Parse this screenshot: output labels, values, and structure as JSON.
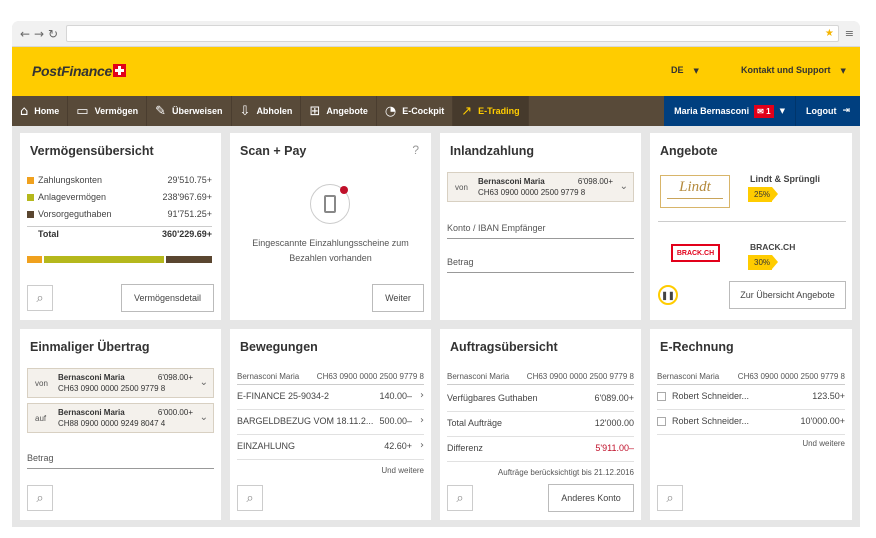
{
  "browser": {
    "back_icon": "back-arrow-icon",
    "forward_icon": "forward-arrow-icon",
    "reload_icon": "reload-icon"
  },
  "brand": {
    "name": "PostFinance",
    "color": "#ffcc00",
    "nav_color": "#584a39",
    "account_color": "#003f7f"
  },
  "header": {
    "language": "DE",
    "support": "Kontakt und Support"
  },
  "nav": {
    "items": [
      {
        "label": "Home",
        "icon": "house-icon"
      },
      {
        "label": "Vermögen",
        "icon": "wallet-icon"
      },
      {
        "label": "Überweisen",
        "icon": "pen-icon"
      },
      {
        "label": "Abholen",
        "icon": "download-icon"
      },
      {
        "label": "Angebote",
        "icon": "gift-icon"
      },
      {
        "label": "E-Cockpit",
        "icon": "chart-pie-icon"
      },
      {
        "label": "E-Trading",
        "icon": "trend-icon"
      }
    ],
    "user": "Maria Bernasconi",
    "messages": "1",
    "logout": "Logout"
  },
  "vermoegen": {
    "title": "Vermögensübersicht",
    "rows": [
      {
        "label": "Zahlungskonten",
        "value": "29'510.75+",
        "color": "#f0a11e"
      },
      {
        "label": "Anlagevermögen",
        "value": "238'967.69+",
        "color": "#b5b81c"
      },
      {
        "label": "Vorsorgeguthaben",
        "value": "91'751.25+",
        "color": "#5a4630"
      }
    ],
    "total_label": "Total",
    "total_value": "360'229.69+",
    "shares": [
      0.082,
      0.663,
      0.255
    ],
    "button": "Vermögensdetail"
  },
  "scanpay": {
    "title": "Scan + Pay",
    "help": "?",
    "message": "Eingescannte Einzahlungsscheine zum Bezahlen vorhanden",
    "button": "Weiter"
  },
  "inland": {
    "title": "Inlandzahlung",
    "from_label": "von",
    "name": "Bernasconi Maria",
    "iban": "CH63 0900 0000 2500 9779 8",
    "amount": "6'098.00+",
    "iban_field": "Konto / IBAN Empfänger",
    "amount_field": "Betrag"
  },
  "angebote": {
    "title": "Angebote",
    "offers": [
      {
        "name": "Lindt & Sprüngli",
        "discount": "25%",
        "logo": "Lindt"
      },
      {
        "name": "BRACK.CH",
        "discount": "30%",
        "logo": "BRACK.CH"
      }
    ],
    "button": "Zur Übersicht Angebote"
  },
  "uebertrag": {
    "title": "Einmaliger Übertrag",
    "from": {
      "label": "von",
      "name": "Bernasconi Maria",
      "iban": "CH63 0900 0000 2500 9779 8",
      "amount": "6'098.00+"
    },
    "to": {
      "label": "auf",
      "name": "Bernasconi Maria",
      "iban": "CH88 0900 0000 9249 8047 4",
      "amount": "6'000.00+"
    },
    "amount_field": "Betrag"
  },
  "bewegungen": {
    "title": "Bewegungen",
    "owner": "Bernasconi Maria",
    "iban": "CH63 0900 0000 2500 9779 8",
    "items": [
      {
        "label": "E-FINANCE 25-9034-2",
        "value": "140.00–"
      },
      {
        "label": "BARGELDBEZUG VOM 18.11.2...",
        "value": "500.00–"
      },
      {
        "label": "EINZAHLUNG",
        "value": "42.60+"
      }
    ],
    "more": "Und weitere"
  },
  "auftraege": {
    "title": "Auftragsübersicht",
    "owner": "Bernasconi Maria",
    "iban": "CH63 0900 0000 2500 9779 8",
    "rows": [
      {
        "label": "Verfügbares Guthaben",
        "value": "6'089.00+"
      },
      {
        "label": "Total Aufträge",
        "value": "12'000.00"
      },
      {
        "label": "Differenz",
        "value": "5'911.00–"
      }
    ],
    "note": "Aufträge berücksichtigt bis 21.12.2016",
    "button": "Anderes Konto"
  },
  "erechnung": {
    "title": "E-Rechnung",
    "owner": "Bernasconi Maria",
    "iban": "CH63 0900 0000 2500 9779 8",
    "items": [
      {
        "label": "Robert Schneider...",
        "value": "123.50+"
      },
      {
        "label": "Robert Schneider...",
        "value": "10'000.00+"
      }
    ],
    "more": "Und weitere"
  }
}
